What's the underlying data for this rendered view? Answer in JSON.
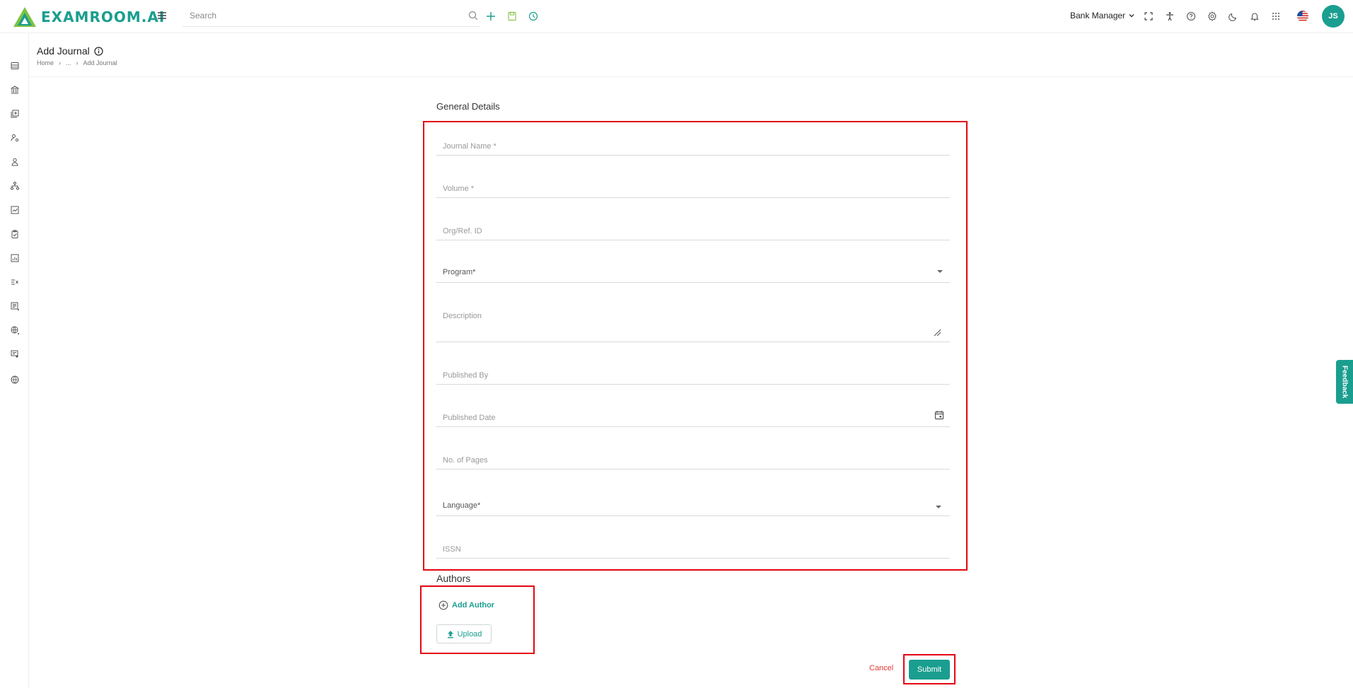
{
  "app": {
    "logo_text": "EXAMROOM.AI"
  },
  "header": {
    "search_placeholder": "Search",
    "role": "Bank Manager",
    "avatar_initials": "JS"
  },
  "page": {
    "title": "Add Journal",
    "breadcrumb": [
      "Home",
      "...",
      "Add Journal"
    ]
  },
  "form": {
    "section_title": "General Details",
    "fields": {
      "journal_name": "Journal Name *",
      "volume": "Volume *",
      "org_ref_id": "Org/Ref. ID",
      "program": "Program*",
      "description": "Description",
      "published_by": "Published By",
      "published_date": "Published Date",
      "no_of_pages": "No. of Pages",
      "language": "Language*",
      "issn": "ISSN"
    }
  },
  "authors": {
    "title": "Authors",
    "add_author": "Add Author",
    "upload": "Upload"
  },
  "actions": {
    "cancel": "Cancel",
    "submit": "Submit"
  },
  "feedback_tab": "Feedback",
  "colors": {
    "primary": "#1a9e8f",
    "danger": "#e30613",
    "cancel": "#e53935"
  }
}
